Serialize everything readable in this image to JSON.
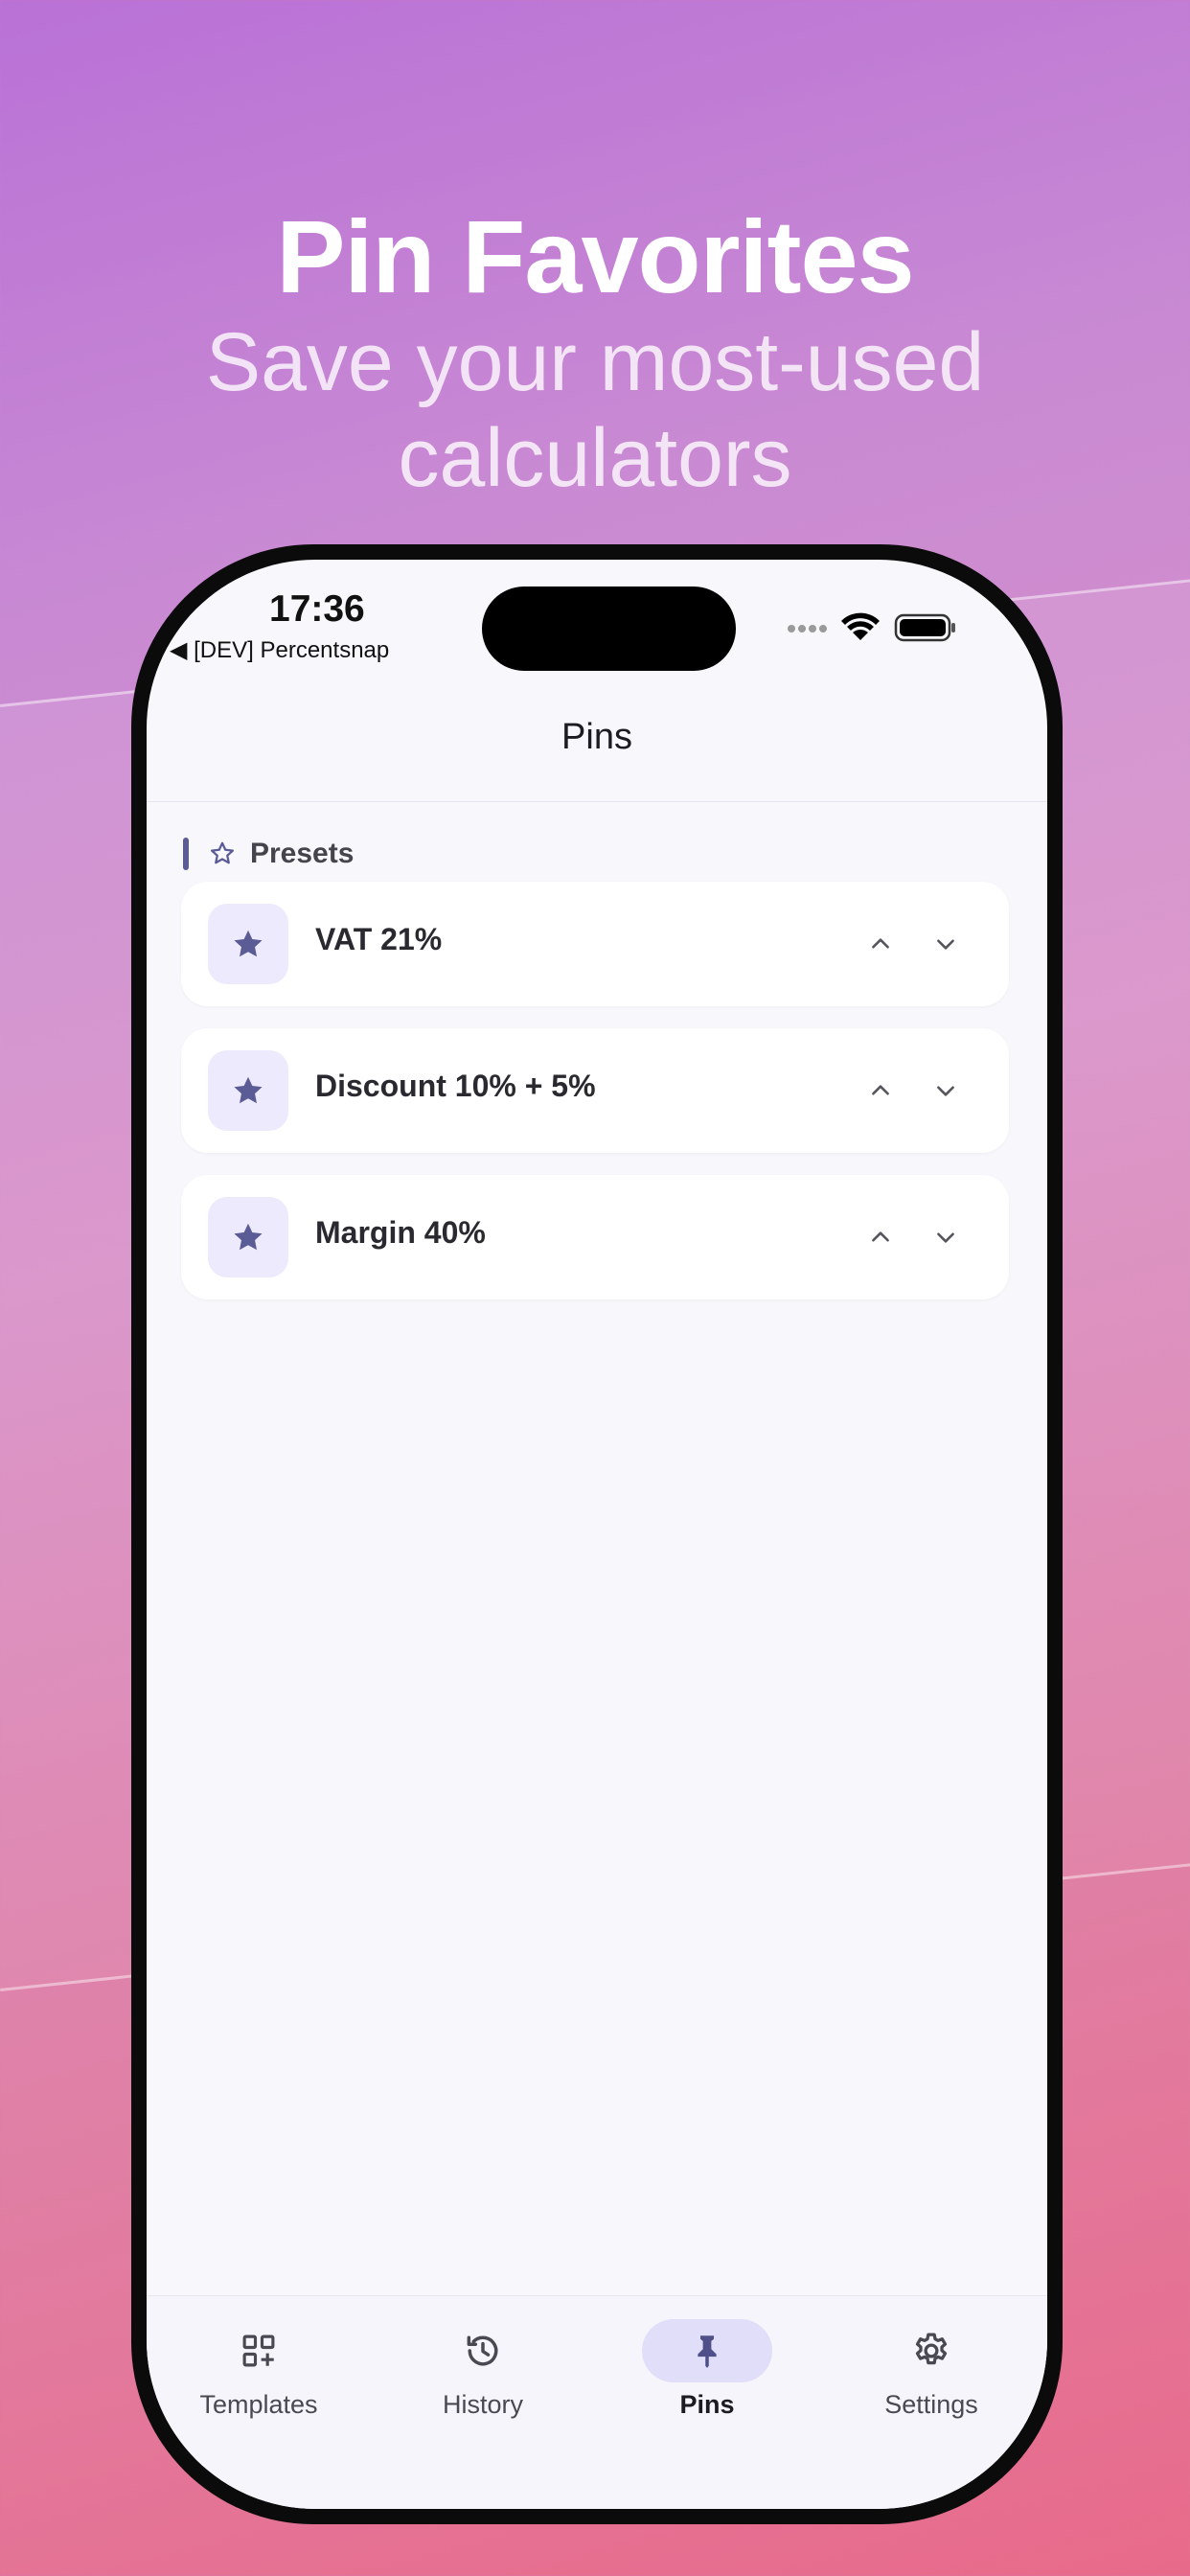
{
  "promo": {
    "title": "Pin Favorites",
    "subtitle": "Save your most-used calculators"
  },
  "status_bar": {
    "time": "17:36",
    "back_label": "◀ [DEV] Percentsnap"
  },
  "app_bar": {
    "title": "Pins"
  },
  "section": {
    "label": "Presets",
    "icon": "star-outline-icon"
  },
  "pins": [
    {
      "label": "VAT 21%",
      "icon": "star-icon"
    },
    {
      "label": "Discount 10% + 5%",
      "icon": "star-icon"
    },
    {
      "label": "Margin 40%",
      "icon": "star-icon"
    }
  ],
  "nav": {
    "items": [
      {
        "label": "Templates",
        "icon": "templates-icon",
        "active": false
      },
      {
        "label": "History",
        "icon": "history-icon",
        "active": false
      },
      {
        "label": "Pins",
        "icon": "pin-icon",
        "active": true
      },
      {
        "label": "Settings",
        "icon": "gear-icon",
        "active": false
      }
    ]
  },
  "colors": {
    "accent": "#5b5b95",
    "icon_bg": "#eceafc",
    "active_pill": "#e0def9",
    "background_top": "#b971d6",
    "background_bottom": "#e86a8a"
  }
}
